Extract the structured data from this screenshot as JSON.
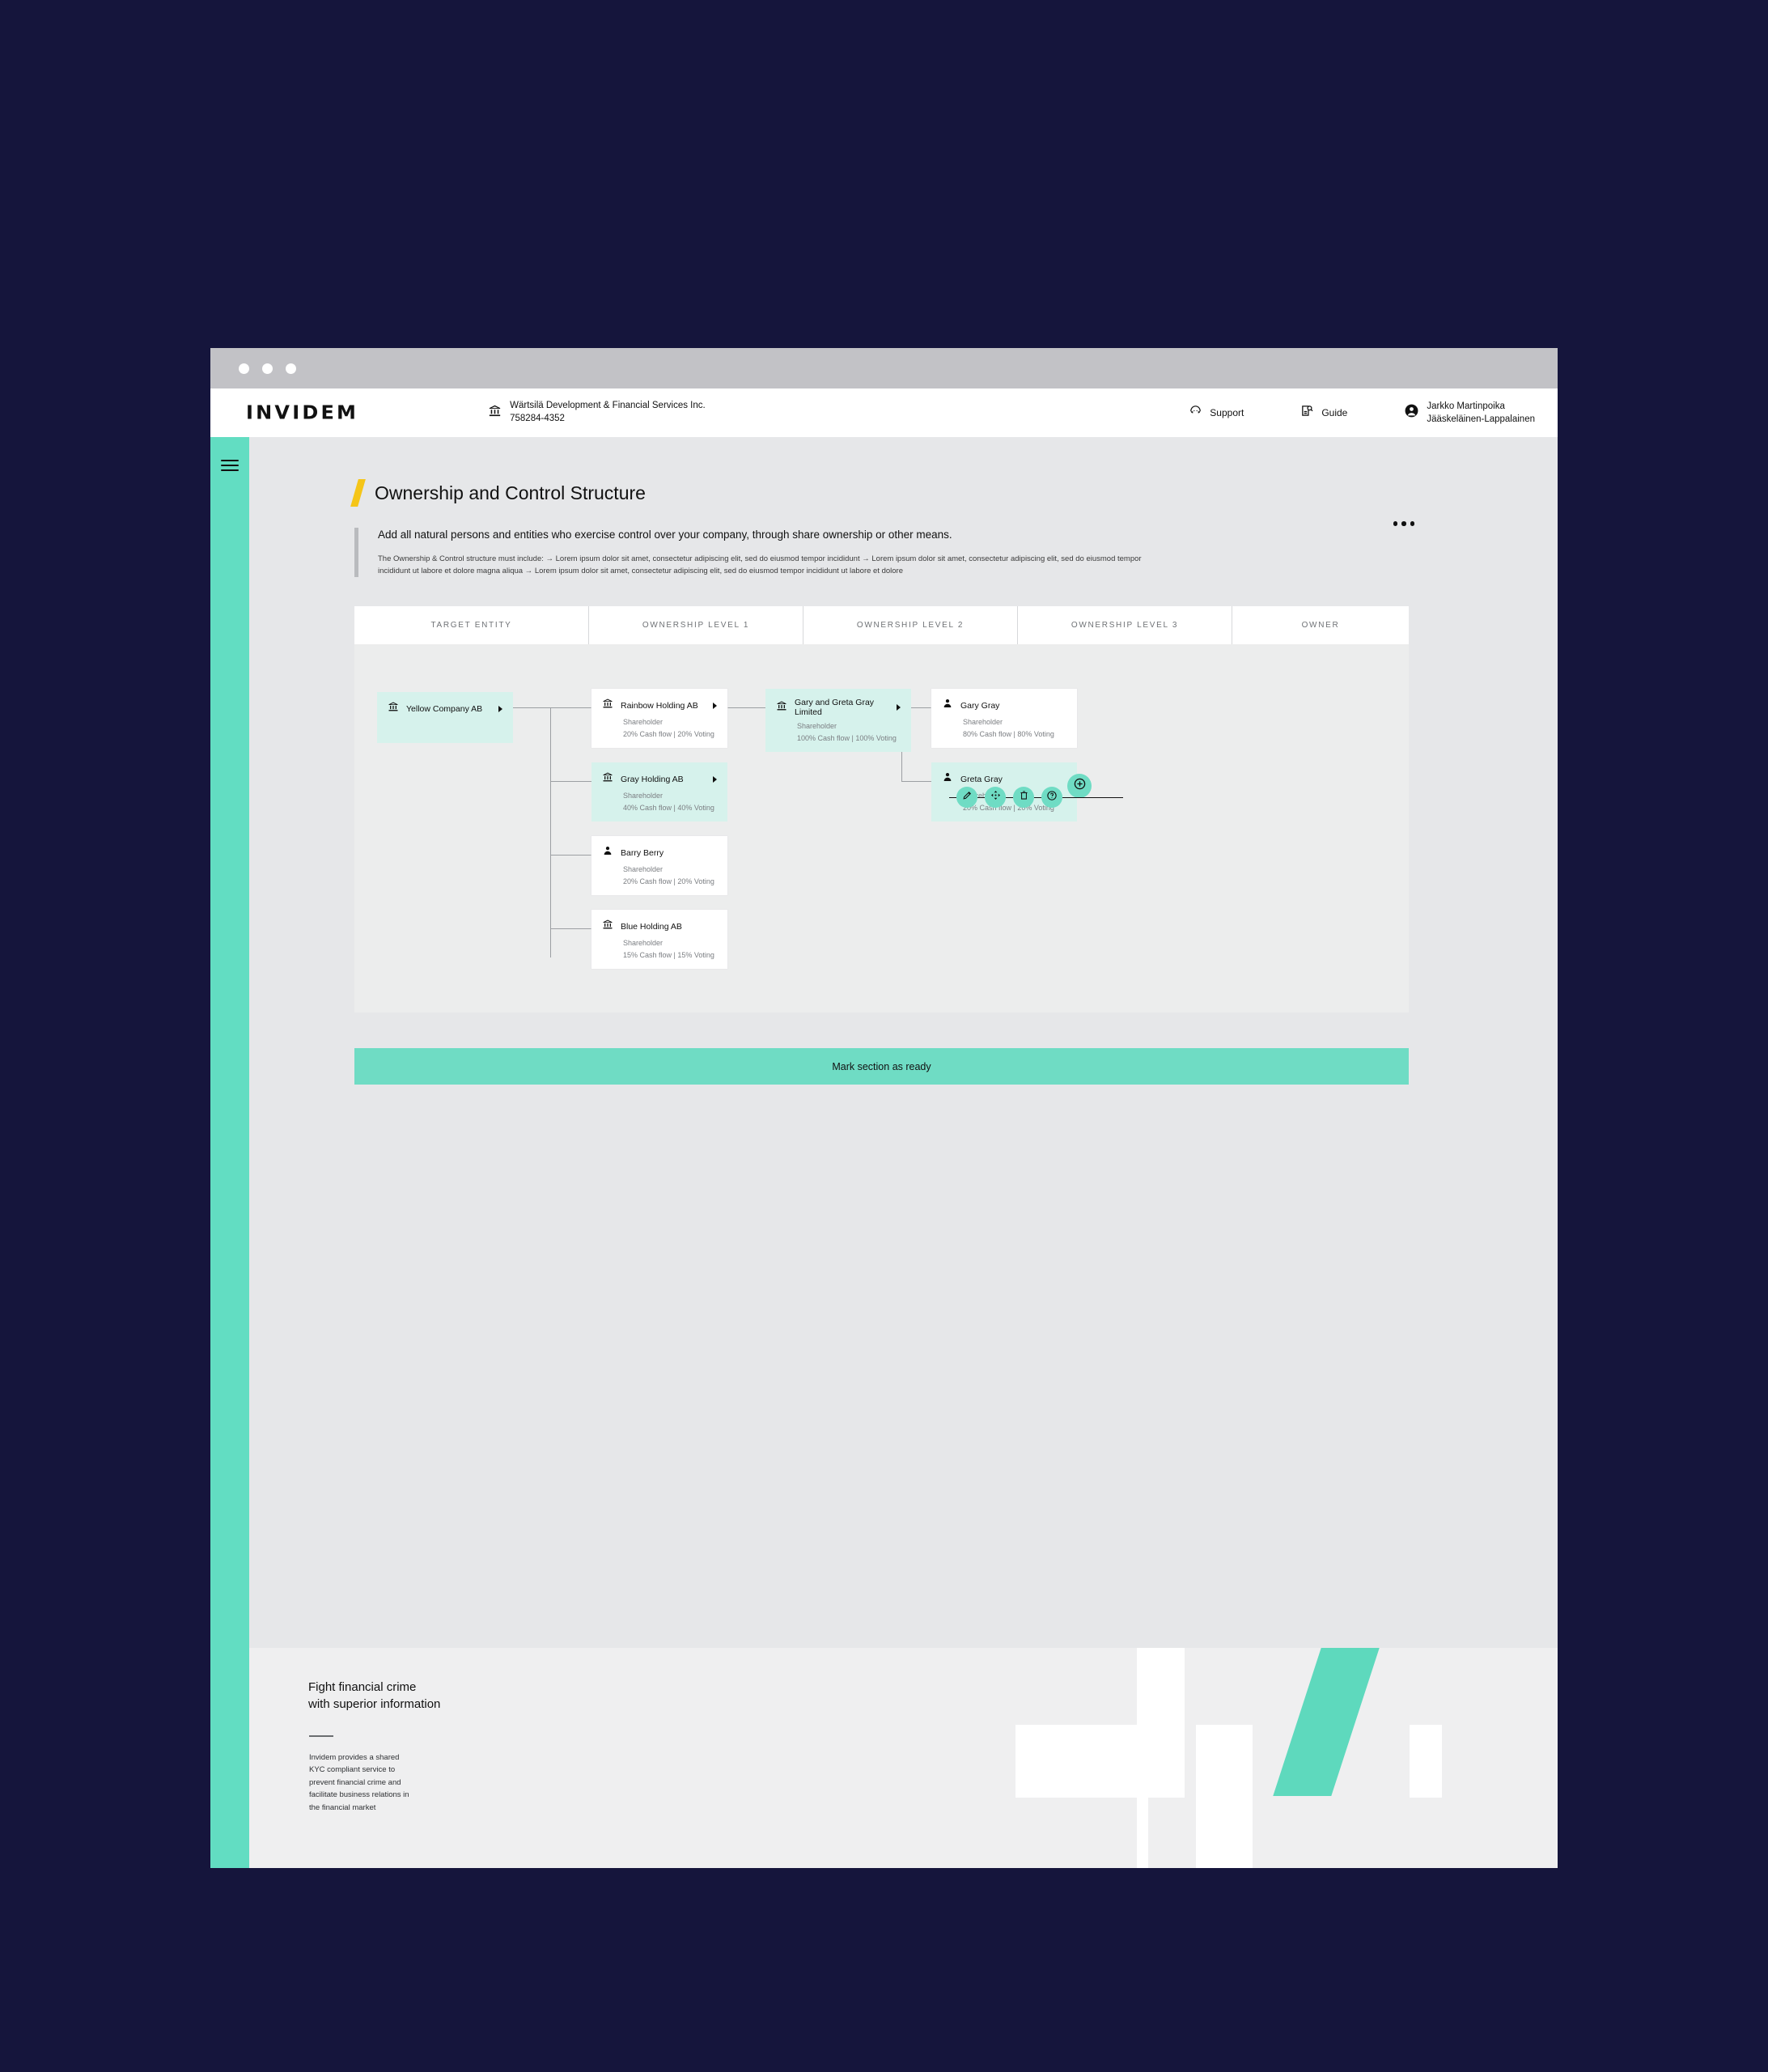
{
  "window": {
    "dots": 3
  },
  "topnav": {
    "logo": "INVIDEM",
    "company": {
      "name": "Wärtsilä Development & Financial Services Inc.",
      "id": "758284-4352"
    },
    "links": [
      {
        "label": "Support",
        "icon": "support-headset-icon"
      },
      {
        "label": "Guide",
        "icon": "guide-document-search-icon"
      }
    ],
    "user": {
      "line1": "Jarkko Martinpoika",
      "line2": "Jääskeläinen-Lappalainen",
      "icon": "account-circle-icon"
    }
  },
  "page": {
    "title": "Ownership and Control Structure",
    "lead": "Add all natural persons and entities who exercise control over your company, through share ownership or other means.",
    "sub": "The Ownership & Control structure must include:  →  Lorem ipsum dolor sit amet, consectetur adipiscing elit, sed do eiusmod tempor incididunt  →  Lorem ipsum dolor sit amet, consectetur adipiscing elit, sed do eiusmod tempor incididunt ut labore et dolore magna aliqua  →  Lorem ipsum dolor sit amet, consectetur adipiscing elit, sed do eiusmod tempor incididunt ut labore et dolore"
  },
  "columns": [
    {
      "label": "TARGET ENTITY"
    },
    {
      "label": "OWNERSHIP LEVEL 1"
    },
    {
      "label": "OWNERSHIP LEVEL 2"
    },
    {
      "label": "OWNERSHIP LEVEL 3"
    },
    {
      "label": "OWNER"
    }
  ],
  "nodes": {
    "target": {
      "name": "Yellow Company AB",
      "icon": "bank-icon",
      "selected": true
    },
    "rainbow": {
      "name": "Rainbow Holding AB",
      "role": "Shareholder",
      "pct": "20% Cash flow | 20% Voting",
      "icon": "bank-icon"
    },
    "grayhold": {
      "name": "Gray Holding AB",
      "role": "Shareholder",
      "pct": "40% Cash flow | 40% Voting",
      "icon": "bank-icon"
    },
    "barry": {
      "name": "Barry Berry",
      "role": "Shareholder",
      "pct": "20% Cash flow | 20% Voting",
      "icon": "person-icon"
    },
    "blue": {
      "name": "Blue Holding AB",
      "role": "Shareholder",
      "pct": "15% Cash flow | 15% Voting",
      "icon": "bank-icon"
    },
    "ggg": {
      "name": "Gary and Greta Gray Limited",
      "role": "Shareholder",
      "pct": "100% Cash flow | 100% Voting",
      "icon": "bank-icon"
    },
    "gary": {
      "name": "Gary Gray",
      "role": "Shareholder",
      "pct": "80% Cash flow | 80% Voting",
      "icon": "person-icon"
    },
    "greta": {
      "name": "Greta Gray",
      "role": "Shareholder",
      "pct": "20% Cash flow | 20% Voting",
      "icon": "person-icon"
    }
  },
  "toolbar": {
    "actions": [
      {
        "name": "edit",
        "icon": "pencil-icon"
      },
      {
        "name": "move",
        "icon": "move-arrows-icon"
      },
      {
        "name": "delete",
        "icon": "trash-icon"
      },
      {
        "name": "help",
        "icon": "question-mark-icon"
      }
    ],
    "add": {
      "name": "add",
      "icon": "plus-circle-icon"
    }
  },
  "cta": {
    "label": "Mark section as ready"
  },
  "footer": {
    "heading_line1": "Fight financial crime",
    "heading_line2": "with superior information",
    "body": "Invidem provides a shared\nKYC compliant service to\nprevent financial crime and\nfacilitate business relations in\nthe financial market"
  },
  "colors": {
    "accent_teal": "#6fdcc4",
    "selection_teal": "#d6f2ec",
    "rail_teal": "#62ddc2",
    "slash_yellow": "#f5c518",
    "page_bg": "#e6e7e9",
    "backdrop": "#15153c"
  }
}
